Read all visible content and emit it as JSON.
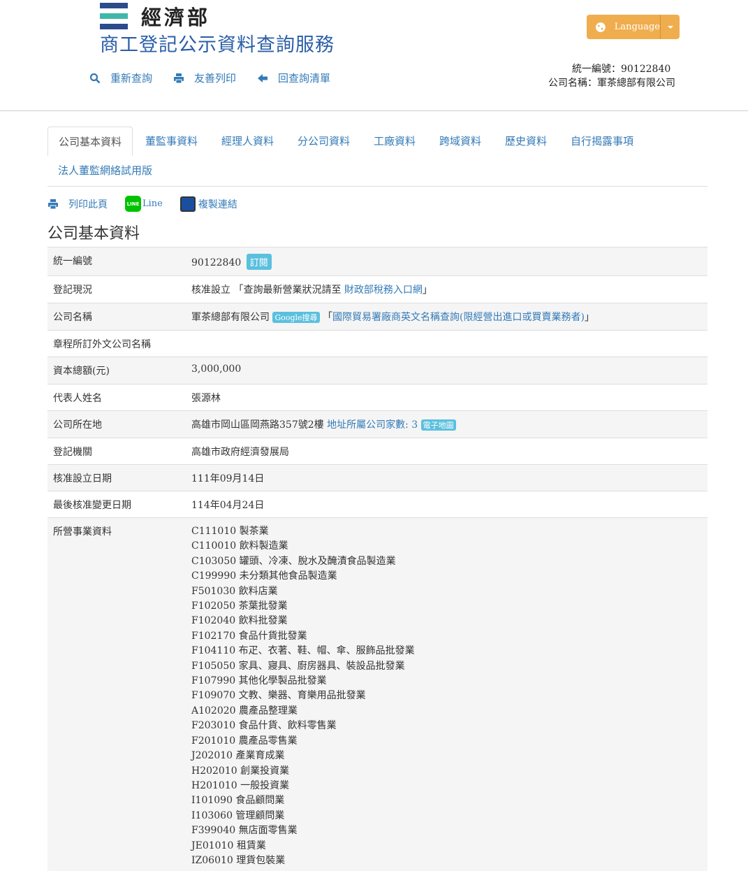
{
  "header": {
    "ministry": "經濟部",
    "site_title": "商工登記公示資料查詢服務",
    "nav": [
      {
        "label": "重新查詢",
        "icon": "search-icon"
      },
      {
        "label": "友善列印",
        "icon": "print-icon"
      },
      {
        "label": "回查詢清單",
        "icon": "arrow-left-icon"
      }
    ],
    "language_label": "Language",
    "company_id_line": "統一編號：90122840",
    "company_name_line": "公司名稱：軍茶總部有限公司"
  },
  "tabs": [
    {
      "label": "公司基本資料",
      "active": true
    },
    {
      "label": "董監事資料",
      "active": false
    },
    {
      "label": "經理人資料",
      "active": false
    },
    {
      "label": "分公司資料",
      "active": false
    },
    {
      "label": "工廠資料",
      "active": false
    },
    {
      "label": "跨域資料",
      "active": false
    },
    {
      "label": "歷史資料",
      "active": false
    },
    {
      "label": "自行揭露事項",
      "active": false
    },
    {
      "label": "法人董監網絡試用版",
      "active": false
    }
  ],
  "tools": {
    "print_label": "列印此頁",
    "line_label": "Line",
    "line_icon_text": "LINE",
    "copy_label": "複製連結"
  },
  "section_title": "公司基本資料",
  "rows": {
    "id": {
      "label": "統一編號",
      "value": "90122840",
      "badge": "訂閱"
    },
    "status": {
      "label": "登記現況",
      "value_prefix": "核准設立 「查詢最新營業狀況請至 ",
      "link": "財政部稅務入口網",
      "value_suffix": "」"
    },
    "name": {
      "label": "公司名稱",
      "value": "軍茶總部有限公司 ",
      "google_badge": "Google搜尋",
      "mid": " 「",
      "link": "國際貿易署廠商英文名稱查詢(限經營出進口或買賣業務者)",
      "suffix": "」"
    },
    "foreign_name": {
      "label": "章程所訂外文公司名稱",
      "value": ""
    },
    "capital": {
      "label": "資本總額(元)",
      "value": "3,000,000"
    },
    "rep": {
      "label": "代表人姓名",
      "value": "張源林"
    },
    "address": {
      "label": "公司所在地",
      "value": "高雄市岡山區岡燕路357號2樓 ",
      "link": "地址所屬公司家數: 3",
      "map_badge": "電子地圖"
    },
    "authority": {
      "label": "登記機關",
      "value": "高雄市政府經濟發展局"
    },
    "approved_date": {
      "label": "核准設立日期",
      "value": "111年09月14日"
    },
    "changed_date": {
      "label": "最後核准變更日期",
      "value": "114年04月24日"
    },
    "business": {
      "label": "所營事業資料",
      "items": [
        "C111010 製茶業",
        "C110010 飲料製造業",
        "C103050 罐頭、冷凍、脫水及醃漬食品製造業",
        "C199990 未分類其他食品製造業",
        "F501030 飲料店業",
        "F102050 茶葉批發業",
        "F102040 飲料批發業",
        "F102170 食品什貨批發業",
        "F104110 布疋、衣著、鞋、帽、傘、服飾品批發業",
        "F105050 家具、寢具、廚房器具、裝設品批發業",
        "F107990 其他化學製品批發業",
        "F109070 文教、樂器、育樂用品批發業",
        "A102020 農產品整理業",
        "F203010 食品什貨、飲料零售業",
        "F201010 農產品零售業",
        "J202010 產業育成業",
        "H202010 創業投資業",
        "H201010 一般投資業",
        "I101090 食品顧問業",
        "I103060 管理顧問業",
        "F399040 無店面零售業",
        "JE01010 租賃業",
        "IZ06010 理貨包裝業"
      ]
    }
  },
  "colors": {
    "link": "#337ab7",
    "title": "#2a5ea7",
    "language_button": "#f0ad4e",
    "badge": "#5bc0de",
    "logo_dark": "#2b4c8c",
    "logo_teal": "#3fb8a8"
  }
}
